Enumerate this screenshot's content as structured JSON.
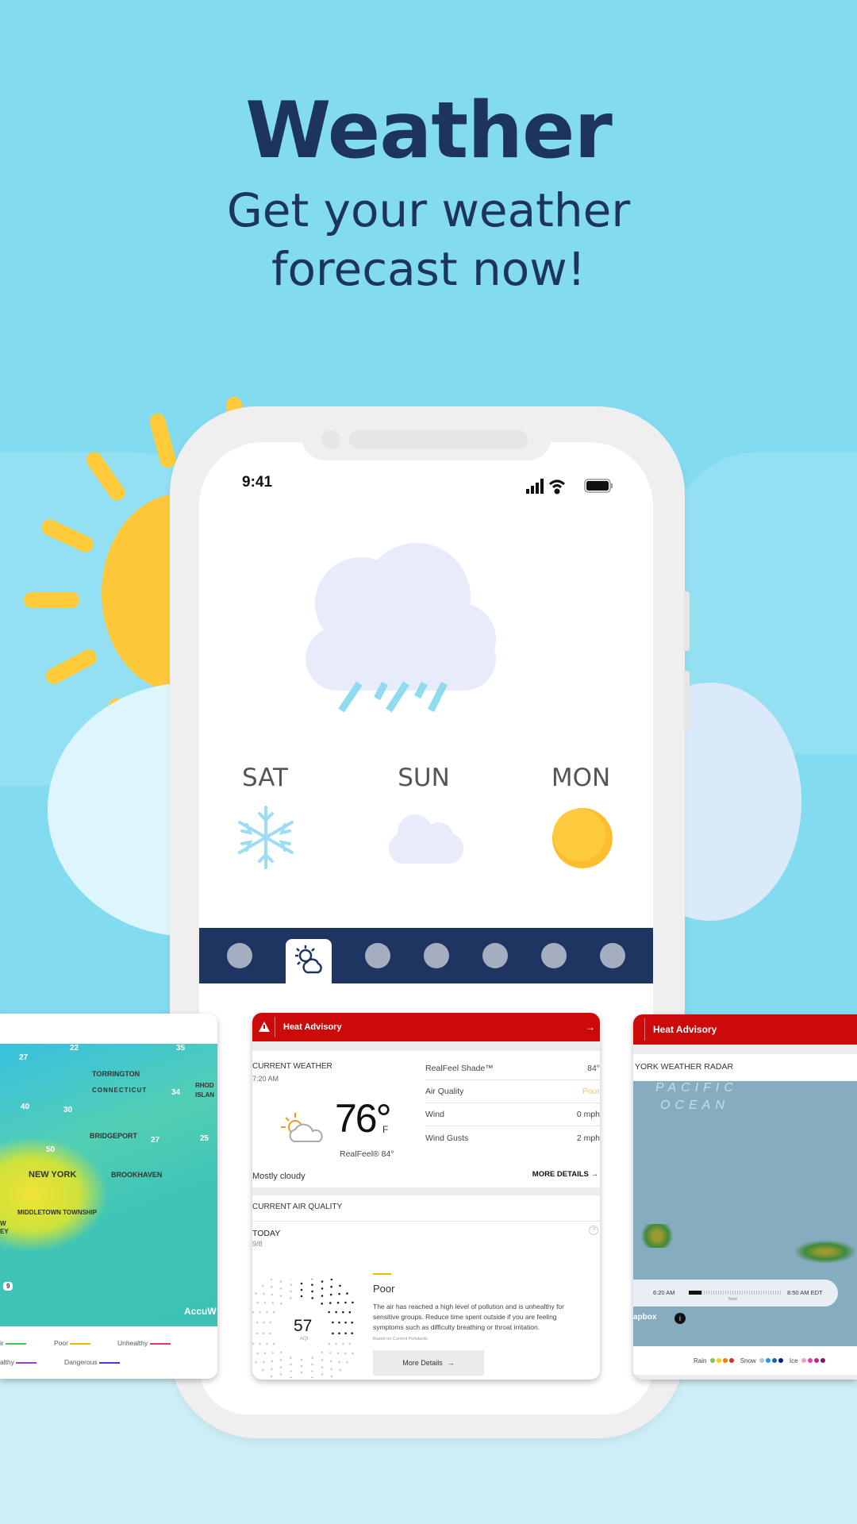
{
  "header": {
    "title": "Weather",
    "subtitle_line1": "Get your weather",
    "subtitle_line2": "forecast now!"
  },
  "phone": {
    "status_time": "9:41",
    "days": [
      {
        "label": "SAT",
        "icon": "snowflake-icon"
      },
      {
        "label": "SUN",
        "icon": "cloud-icon"
      },
      {
        "label": "MON",
        "icon": "sun-icon"
      }
    ],
    "main_icon": "rain-cloud-icon",
    "nav_active_icon": "partly-cloudy-icon",
    "nav_count": 7
  },
  "center_card": {
    "alert": "Heat Advisory",
    "current_weather_label": "CURRENT WEATHER",
    "time": "7:20 AM",
    "temperature": "76°",
    "unit": "F",
    "realfeel": "RealFeel® 84°",
    "condition": "Mostly cloudy",
    "details": [
      {
        "label": "RealFeel Shade™",
        "value": "84°"
      },
      {
        "label": "Air Quality",
        "value": "Poor"
      },
      {
        "label": "Wind",
        "value": "0 mph"
      },
      {
        "label": "Wind Gusts",
        "value": "2 mph"
      }
    ],
    "more_details": "MORE DETAILS",
    "air_quality_label": "CURRENT AIR QUALITY",
    "today": "TODAY",
    "date": "9/8",
    "aqi": "57",
    "aqi_unit": "AQI",
    "aqi_level": "Poor",
    "aqi_desc": "The air has reached a high level of pollution and is unhealthy for sensitive groups. Reduce time spent outside if you are feeling symptoms such as difficulty breathing or throat irritation.",
    "aqi_note": "Based on Current Pollutants",
    "more_details_btn": "More Details",
    "colors": {
      "alert": "#cc0a0a",
      "poor": "#f5b400"
    }
  },
  "left_card": {
    "map_labels": [
      "TORRINGTON",
      "CONNECTICUT",
      "RHOD",
      "ISLAN",
      "BRIDGEPORT",
      "NEW YORK",
      "BROOKHAVEN",
      "MIDDLETOWN TOWNSHIP",
      "W",
      "EY",
      "9"
    ],
    "map_values": [
      "27",
      "22",
      "35",
      "40",
      "30",
      "34",
      "50",
      "27",
      "25"
    ],
    "attribution": "AccuW",
    "legend": [
      {
        "label": "ir",
        "color": "#3cc65a"
      },
      {
        "label": "Poor",
        "color": "#f5b400"
      },
      {
        "label": "Unhealthy",
        "color": "#e9336a"
      },
      {
        "label": "althy",
        "color": "#a53ad0"
      },
      {
        "label": "Dangerous",
        "color": "#5a2ee0"
      }
    ]
  },
  "right_card": {
    "alert": "Heat Advisory",
    "radar_title": "YORK WEATHER RADAR",
    "ocean1": "PACIFIC",
    "ocean2": "OCEAN",
    "start_time": "6:20 AM",
    "end_time": "8:50 AM EDT",
    "now": "Now",
    "attribution": "apbox",
    "legend": [
      {
        "label": "Rain",
        "colors": [
          "#8bc34a",
          "#f5d000",
          "#f57c00",
          "#d32f2f"
        ]
      },
      {
        "label": "Snow",
        "colors": [
          "#9ecbf0",
          "#2196f3",
          "#1565c0",
          "#0d1a8a"
        ]
      },
      {
        "label": "Ice",
        "colors": [
          "#f0a0d0",
          "#e040a0",
          "#c0208a",
          "#8a1070"
        ]
      }
    ]
  }
}
